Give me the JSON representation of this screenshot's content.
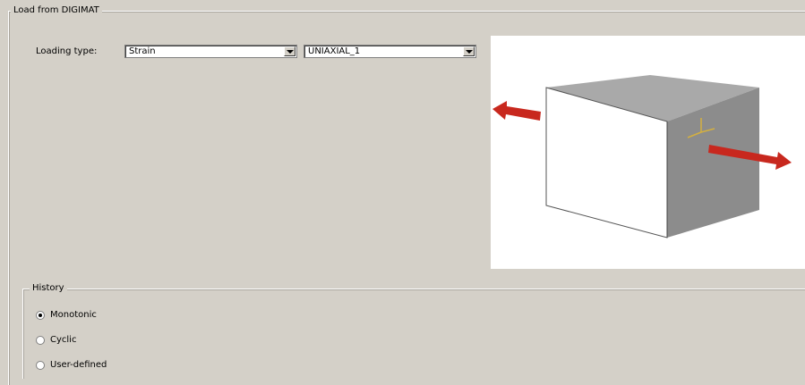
{
  "group_title": "Load from DIGIMAT",
  "loading": {
    "label": "Loading type:",
    "type_value": "Strain",
    "case_value": "UNIAXIAL_1"
  },
  "history": {
    "title": "History",
    "options": [
      {
        "label": "Monotonic",
        "checked": true
      },
      {
        "label": "Cyclic",
        "checked": false
      },
      {
        "label": "User-defined",
        "checked": false
      }
    ]
  },
  "colors": {
    "arrow": "#c8281e",
    "cube_front": "#ffffff",
    "cube_top": "#a9a9a9",
    "cube_side": "#8c8c8c",
    "axis": "#d4b040"
  }
}
